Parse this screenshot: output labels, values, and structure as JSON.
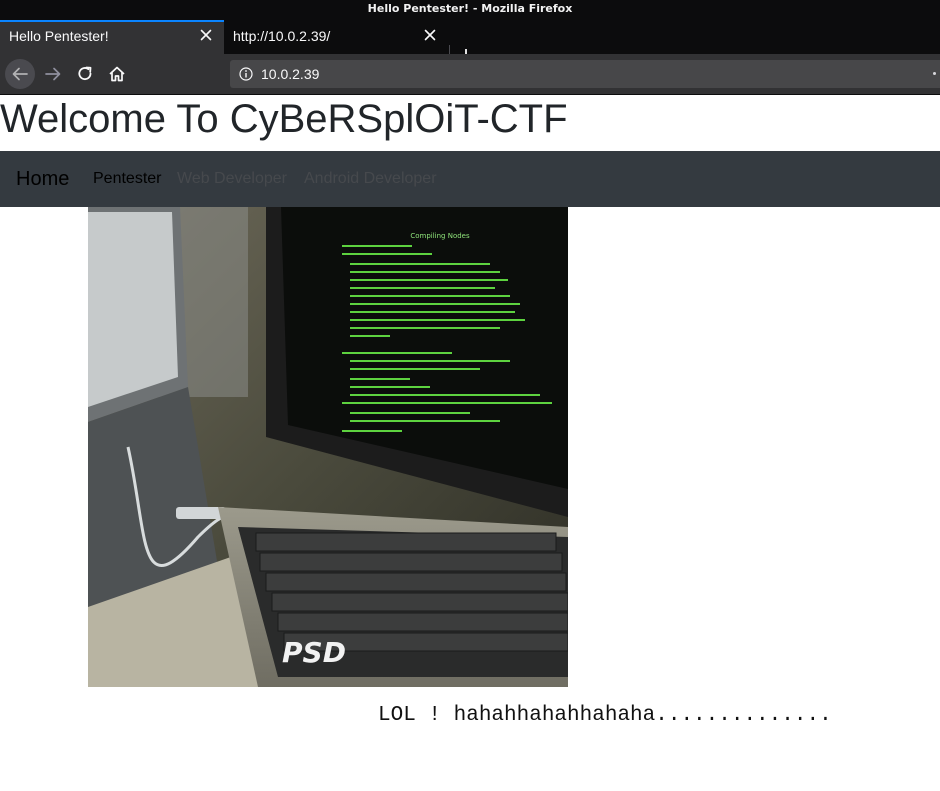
{
  "window": {
    "title": "Hello Pentester! - Mozilla Firefox"
  },
  "tabs": [
    {
      "label": "Hello Pentester!",
      "active": true
    },
    {
      "label": "http://10.0.2.39/",
      "active": false
    }
  ],
  "toolbar": {
    "url": "10.0.2.39"
  },
  "site": {
    "heading": "Welcome To CyBeRSplOiT-CTF",
    "brand": "Home",
    "nav": [
      "Pentester",
      "Web Developer",
      "Android Developer"
    ]
  },
  "hero": {
    "screen_title": "Compiling Nodes",
    "watermark": "PSD",
    "caption": "LOL ! hahahhahahhahaha.............."
  },
  "colors": {
    "accent": "#0a84ff",
    "nav_bg": "#343a40",
    "terminal_green": "#5dd23f"
  }
}
